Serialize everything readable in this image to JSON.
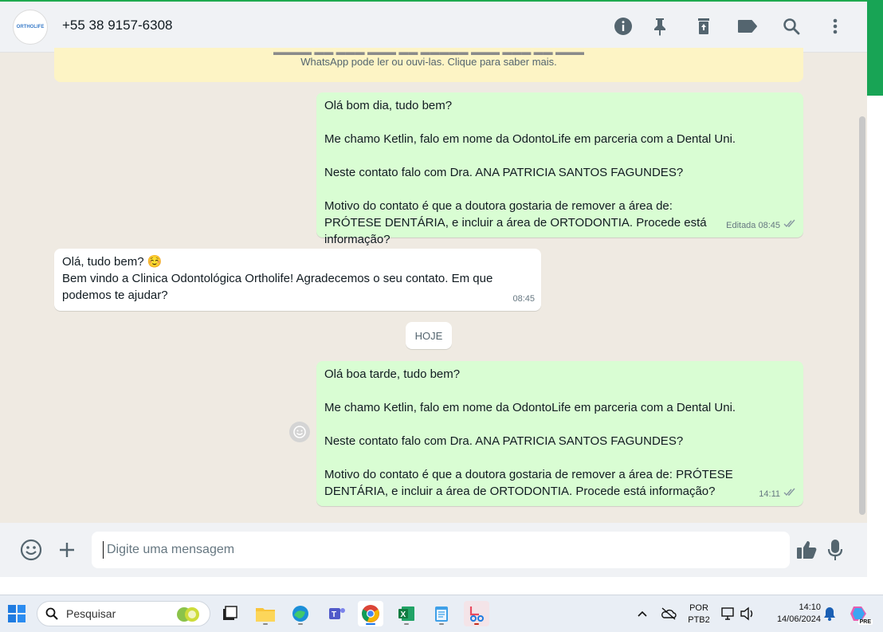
{
  "header": {
    "avatar_text": "ORTHOLIFE",
    "contact": "+55 38 9157-6308",
    "icons": [
      "info-icon",
      "pin-icon",
      "delete-icon",
      "label-icon",
      "search-icon",
      "menu-icon"
    ]
  },
  "banner": {
    "line2": "WhatsApp pode ler ou ouvi-las. Clique para saber mais."
  },
  "messages": [
    {
      "lines": [
        "Olá bom dia, tudo bem?",
        "",
        "Me chamo Ketlin, falo em nome da OdontoLife em parceria com a Dental Uni.",
        "",
        "Neste contato falo com Dra. ANA PATRICIA SANTOS FAGUNDES?",
        "",
        "Motivo do contato é que a doutora gostaria de remover a área de: PRÓTESE DENTÁRIA, e incluir a área de ORTODONTIA. Procede está informação?"
      ],
      "meta": "Editada 08:45"
    },
    {
      "line1": "Olá, tudo bem? ☺️",
      "line2": "Bem vindo a Clinica Odontológica Ortholife! Agradecemos o seu contato. Em que podemos te ajudar?",
      "time": "08:45"
    },
    {
      "lines": [
        "Olá boa tarde, tudo bem?",
        "",
        "Me chamo Ketlin, falo em nome da OdontoLife em parceria com a Dental Uni.",
        "",
        "Neste contato falo com Dra. ANA PATRICIA SANTOS FAGUNDES?",
        "",
        "Motivo do contato é que a doutora gostaria de remover a área de: PRÓTESE DENTÁRIA, e incluir a área de ORTODONTIA. Procede está informação?"
      ],
      "time": "14:11"
    }
  ],
  "date_separator": "HOJE",
  "composer": {
    "placeholder": "Digite uma mensagem"
  },
  "taskbar": {
    "search_placeholder": "Pesquisar",
    "lang1": "POR",
    "lang2": "PTB2",
    "time": "14:10",
    "date": "14/06/2024",
    "copilot_badge": "PRE"
  },
  "colors": {
    "outgoing": "#d9fdd3",
    "incoming": "#ffffff",
    "accent": "#1faa4f",
    "banner": "#fdf4c5"
  }
}
